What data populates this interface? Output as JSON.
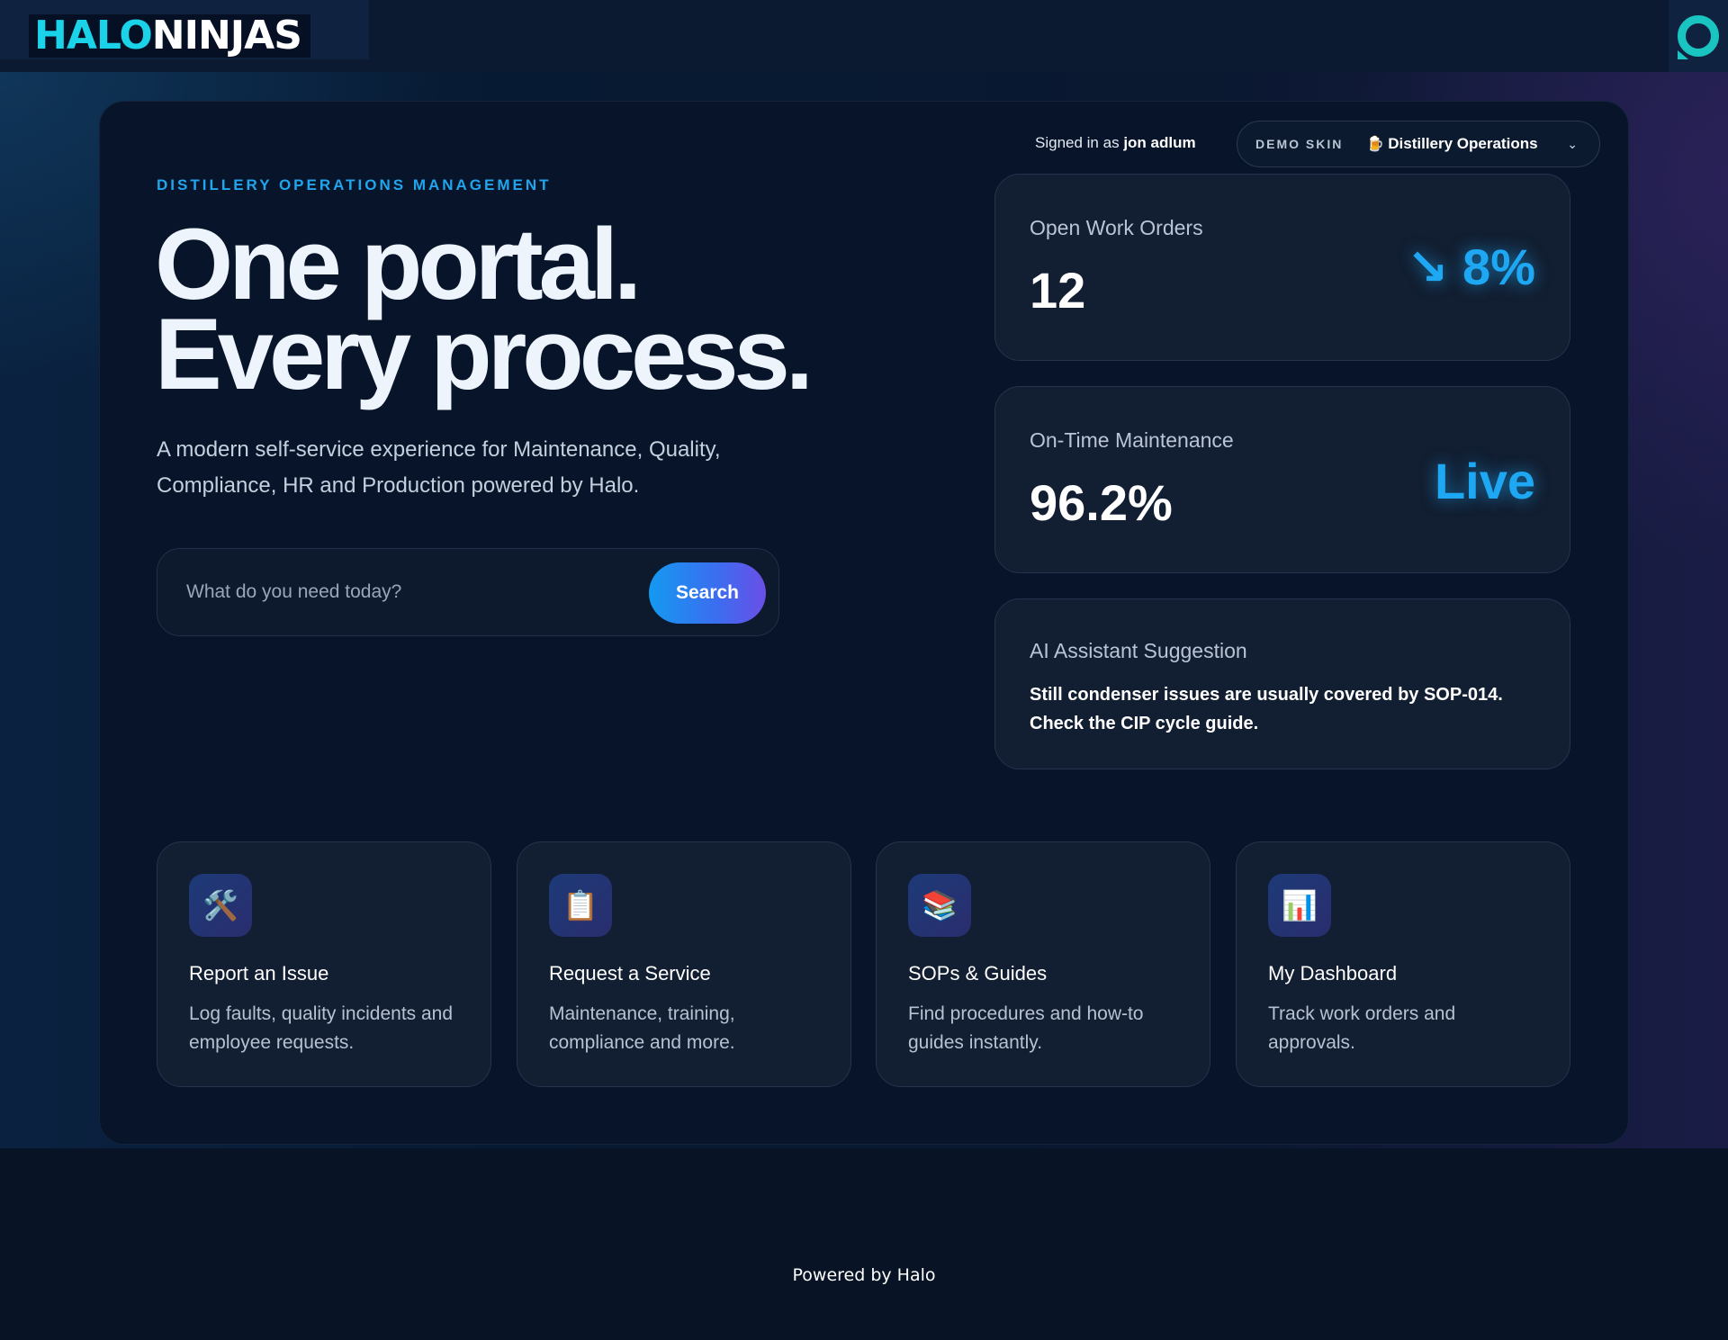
{
  "brand": {
    "halo": "HALO",
    "ninjas": "NINJAS"
  },
  "user": {
    "prefix": "Signed in as",
    "name": "jon adlum"
  },
  "skin": {
    "tag": "DEMO SKIN",
    "emoji": "🍺",
    "value": "Distillery Operations"
  },
  "hero": {
    "eyebrow": "DISTILLERY OPERATIONS MANAGEMENT",
    "line1": "One portal.",
    "line2": "Every process.",
    "sub": "A modern self-service experience for Maintenance, Quality, Compliance, HR and Production powered by Halo."
  },
  "search": {
    "placeholder": "What do you need today?",
    "button": "Search"
  },
  "stats": [
    {
      "label": "Open Work Orders",
      "value": "12",
      "accent": "↘ 8%"
    },
    {
      "label": "On-Time Maintenance",
      "value": "96.2%",
      "accent": "Live"
    }
  ],
  "assistant": {
    "label": "AI Assistant Suggestion",
    "text": "Still condenser issues are usually covered by SOP-014. Check the CIP cycle guide."
  },
  "tiles": [
    {
      "icon": "tools-icon",
      "glyph": "🛠️",
      "title": "Report an Issue",
      "desc": "Log faults, quality incidents and employee requests."
    },
    {
      "icon": "clipboard-icon",
      "glyph": "📋",
      "title": "Request a Service",
      "desc": "Maintenance, training, compliance and more."
    },
    {
      "icon": "books-icon",
      "glyph": "📚",
      "title": "SOPs & Guides",
      "desc": "Find procedures and how-to guides instantly."
    },
    {
      "icon": "bar-chart-icon",
      "glyph": "📊",
      "title": "My Dashboard",
      "desc": "Track work orders and approvals."
    }
  ],
  "footer": {
    "text": "Powered by Halo"
  },
  "colors": {
    "accent": "#1ea7f2",
    "brand_cyan": "#1ad3e8",
    "background": "#081326"
  }
}
